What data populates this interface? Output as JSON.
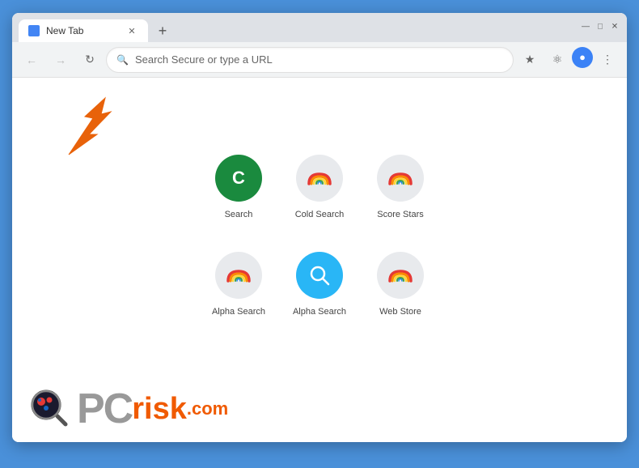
{
  "browser": {
    "tab_title": "New Tab",
    "address_bar_placeholder": "Search Secure or type a URL",
    "window_controls": {
      "minimize": "—",
      "maximize": "□",
      "close": "✕"
    }
  },
  "shortcuts": [
    {
      "id": 1,
      "label": "Search",
      "type": "letter",
      "letter": "C",
      "color": "green"
    },
    {
      "id": 2,
      "label": "Cold Search",
      "type": "rainbow"
    },
    {
      "id": 3,
      "label": "Score Stars",
      "type": "rainbow"
    },
    {
      "id": 4,
      "label": "Alpha Search",
      "type": "rainbow"
    },
    {
      "id": 5,
      "label": "Alpha Search",
      "type": "rainbow2"
    },
    {
      "id": 6,
      "label": "Web Store",
      "type": "rainbow"
    }
  ],
  "watermark": {
    "pc": "PC",
    "risk": "risk",
    "dotcom": ".com"
  }
}
